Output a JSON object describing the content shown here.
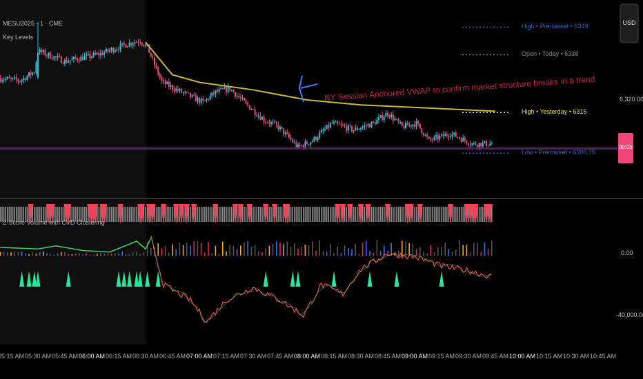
{
  "header": {
    "symbol": "MESU2025 · 1 · CME",
    "indicator_1": "Key Levels",
    "indicator_2": "Z-Score Volume with CVD Clustering"
  },
  "currency_button": "USD",
  "colors": {
    "bull": "#26c6da",
    "bear": "#f0477a",
    "vwap": "#c8b93a",
    "level_blue": "#2f5fd0",
    "level_gray": "#888888",
    "level_yellow": "#e8e03a",
    "price_tag": "#f0477a",
    "triangle": "#1de9a0",
    "session_shade": "#0f0f0f"
  },
  "key_levels": [
    {
      "label": "High • Premarket • 6349",
      "price": 6349,
      "color": "#2f5fd0"
    },
    {
      "label": "Open • Today • 6338",
      "price": 6338,
      "color": "#888888"
    },
    {
      "label": "High • Yesterday • 6315",
      "price": 6315,
      "color": "#e8e03a"
    },
    {
      "label": "Low • Premarket • 6300.75",
      "price": 6300.75,
      "color": "#2f5fd0"
    }
  ],
  "annotation": "NY Session Anchored VWAP to confirm market structure breaks in a trend",
  "price_tag": "00:05",
  "chart_data": [
    {
      "type": "candlestick",
      "title": "MESU2025 · 1 · CME",
      "y_ticks": [
        "6,320.00"
      ],
      "x_ticks": [
        "05:15 AM",
        "05:30 AM",
        "05:45 AM",
        "06:00 AM",
        "06:15 AM",
        "06:30 AM",
        "06:45 AM",
        "07:00 AM",
        "07:15 AM",
        "07:30 AM",
        "07:45 AM",
        "08:00 AM",
        "08:15 AM",
        "08:30 AM",
        "08:45 AM",
        "09:00 AM",
        "09:15 AM",
        "09:30 AM",
        "09:45 AM",
        "10:00 AM",
        "10:15 AM",
        "10:30 AM",
        "10:45 AM"
      ],
      "close_path": [
        [
          "05:09",
          6328.6
        ],
        [
          "05:20",
          6327.7
        ],
        [
          "05:28",
          6331.3
        ],
        [
          "05:30",
          6339.5
        ],
        [
          "05:45",
          6335.4
        ],
        [
          "06:04",
          6338.2
        ],
        [
          "06:23",
          6343.1
        ],
        [
          "06:27",
          6343.7
        ],
        [
          "06:31",
          6340.9
        ],
        [
          "06:39",
          6327.2
        ],
        [
          "06:46",
          6324.5
        ],
        [
          "07:02",
          6319
        ],
        [
          "07:09",
          6323.1
        ],
        [
          "07:17",
          6324.5
        ],
        [
          "07:25",
          6319
        ],
        [
          "07:36",
          6312.1
        ],
        [
          "07:44",
          6309.3
        ],
        [
          "07:55",
          6301.1
        ],
        [
          "08:03",
          6303.8
        ],
        [
          "08:14",
          6310.7
        ],
        [
          "08:26",
          6308
        ],
        [
          "08:37",
          6310.7
        ],
        [
          "08:45",
          6314.8
        ],
        [
          "08:53",
          6309.3
        ],
        [
          "09:01",
          6310.7
        ],
        [
          "09:08",
          6303.8
        ],
        [
          "09:20",
          6306.6
        ],
        [
          "09:32",
          6302.5
        ],
        [
          "09:43",
          6302.5
        ]
      ],
      "vwap_path": [
        [
          "06:30",
          6343
        ],
        [
          "06:45",
          6330
        ],
        [
          "07:00",
          6327
        ],
        [
          "07:30",
          6324
        ],
        [
          "08:00",
          6320
        ],
        [
          "08:30",
          6318
        ],
        [
          "09:00",
          6317
        ],
        [
          "09:45",
          6315.5
        ]
      ]
    },
    {
      "type": "line",
      "title": "Z-Score Volume with CVD Clustering",
      "y_ticks": [
        "0.00",
        "-40,000.00"
      ],
      "cvd_path": [
        [
          "05:09",
          4000
        ],
        [
          "05:30",
          3000
        ],
        [
          "05:40",
          5000
        ],
        [
          "05:55",
          2000
        ],
        [
          "06:10",
          1000
        ],
        [
          "06:25",
          8000
        ],
        [
          "06:30",
          3000
        ],
        [
          "06:33",
          10000
        ],
        [
          "06:40",
          -20000
        ],
        [
          "06:55",
          -30000
        ],
        [
          "07:04",
          -44000
        ],
        [
          "07:15",
          -30000
        ],
        [
          "07:30",
          -22000
        ],
        [
          "07:45",
          -30000
        ],
        [
          "07:58",
          -40000
        ],
        [
          "08:08",
          -20000
        ],
        [
          "08:20",
          -26000
        ],
        [
          "08:30",
          -10000
        ],
        [
          "08:45",
          0
        ],
        [
          "09:00",
          -2000
        ],
        [
          "09:15",
          -8000
        ],
        [
          "09:30",
          -11000
        ],
        [
          "09:43",
          -15000
        ]
      ],
      "signal_triangles": [
        "05:21",
        "05:25",
        "05:28",
        "05:30",
        "05:47",
        "06:15",
        "06:18",
        "06:21",
        "06:25",
        "06:27",
        "06:31",
        "06:37",
        "07:37",
        "07:52",
        "07:55",
        "08:15",
        "08:35",
        "08:50",
        "09:15"
      ]
    }
  ]
}
